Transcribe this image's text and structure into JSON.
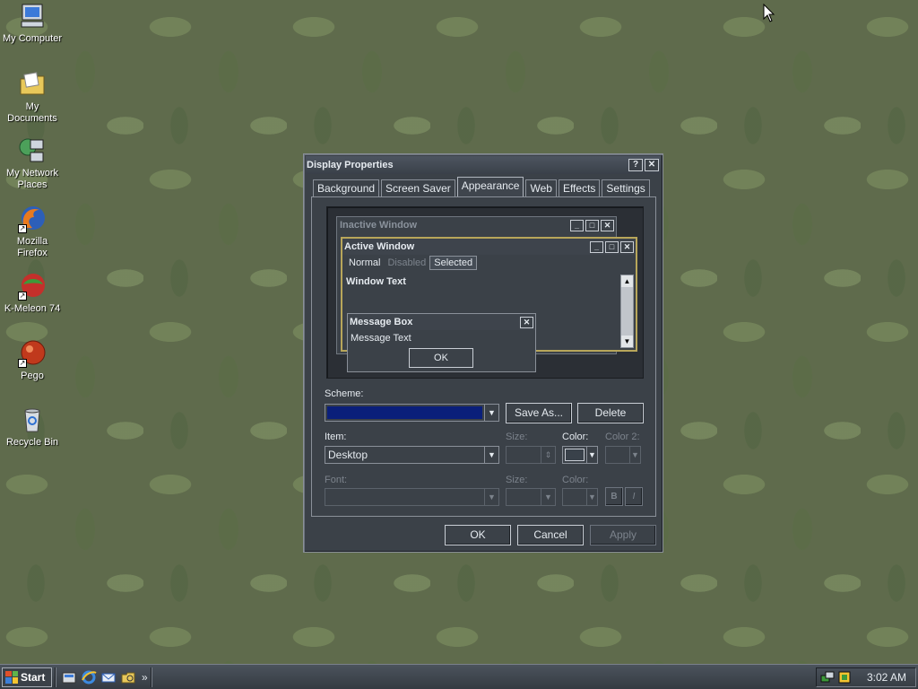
{
  "desktop": {
    "icons": [
      {
        "label": "My Computer"
      },
      {
        "label": "My Documents"
      },
      {
        "label": "My Network Places"
      },
      {
        "label": "Mozilla Firefox"
      },
      {
        "label": "K-Meleon 74"
      },
      {
        "label": "Pego"
      },
      {
        "label": "Recycle Bin"
      }
    ]
  },
  "dialog": {
    "title": "Display Properties",
    "help_btn": "?",
    "close_btn": "✕",
    "tabs": [
      "Background",
      "Screen Saver",
      "Appearance",
      "Web",
      "Effects",
      "Settings"
    ],
    "active_tab": "Appearance",
    "preview": {
      "inactive_title": "Inactive Window",
      "active_title": "Active Window",
      "menu_normal": "Normal",
      "menu_disabled": "Disabled",
      "menu_selected": "Selected",
      "window_text": "Window Text",
      "msgbox_title": "Message Box",
      "msgbox_text": "Message Text",
      "msgbox_ok": "OK"
    },
    "scheme_label": "Scheme:",
    "scheme_value": "",
    "save_as": "Save As...",
    "delete": "Delete",
    "item_label": "Item:",
    "item_value": "Desktop",
    "size_label": "Size:",
    "color_label": "Color:",
    "color2_label": "Color 2:",
    "font_label": "Font:",
    "font_size_label": "Size:",
    "font_color_label": "Color:",
    "bold_btn": "B",
    "italic_btn": "I",
    "ok": "OK",
    "cancel": "Cancel",
    "apply": "Apply"
  },
  "taskbar": {
    "start": "Start",
    "overflow": "»",
    "clock": "3:02 AM"
  },
  "colors": {
    "desktop_bg": "#5f6b4c",
    "dialog_bg": "#3b4148",
    "scheme_selected": "#0a1f7a",
    "frame_accent": "#b8a65a"
  }
}
